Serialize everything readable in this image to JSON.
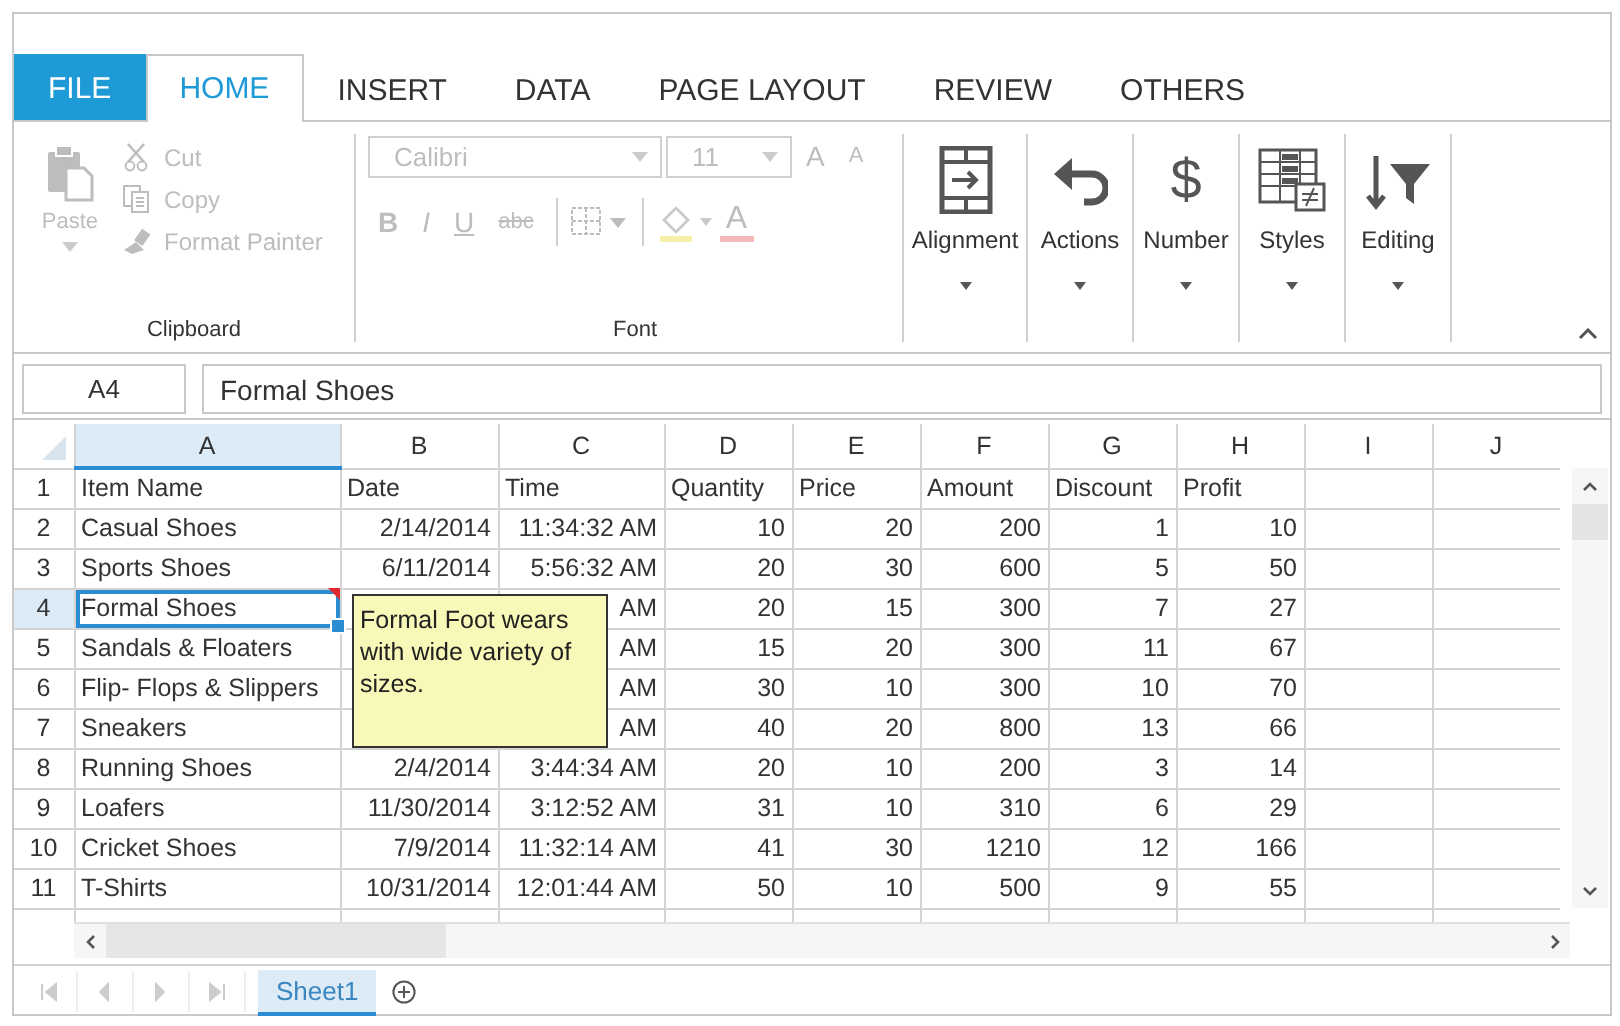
{
  "tabs": [
    {
      "label": "FILE",
      "kind": "file",
      "selected": false
    },
    {
      "label": "HOME",
      "kind": "tab",
      "selected": true
    },
    {
      "label": "INSERT",
      "kind": "tab",
      "selected": false
    },
    {
      "label": "DATA",
      "kind": "tab",
      "selected": false
    },
    {
      "label": "PAGE LAYOUT",
      "kind": "tab",
      "selected": false
    },
    {
      "label": "REVIEW",
      "kind": "tab",
      "selected": false
    },
    {
      "label": "OTHERS",
      "kind": "tab",
      "selected": false
    }
  ],
  "ribbon": {
    "clipboard": {
      "label": "Clipboard",
      "paste": {
        "label": "Paste",
        "disabled": true
      },
      "items": [
        {
          "label": "Cut",
          "kind": "cut",
          "disabled": true
        },
        {
          "label": "Copy",
          "kind": "copy",
          "disabled": true
        },
        {
          "label": "Format Painter",
          "kind": "painter",
          "disabled": true
        }
      ]
    },
    "font": {
      "label": "Font",
      "controls": [
        {
          "kind": "font_name",
          "value": "Calibri",
          "disabled": true
        },
        {
          "kind": "font_size",
          "value": "11",
          "disabled": true
        },
        {
          "kind": "grow",
          "label": "A",
          "disabled": true
        },
        {
          "kind": "shrink",
          "label": "A",
          "disabled": true
        },
        {
          "kind": "bold",
          "label": "B",
          "disabled": true
        },
        {
          "kind": "italic",
          "label": "I",
          "disabled": true
        },
        {
          "kind": "underline",
          "label": "U",
          "disabled": true
        },
        {
          "kind": "strike",
          "label": "abc",
          "disabled": true
        },
        {
          "kind": "borders",
          "disabled": true
        },
        {
          "kind": "fill",
          "disabled": true
        },
        {
          "kind": "font_color",
          "label": "A",
          "disabled": true
        }
      ]
    },
    "groups": [
      {
        "label": "Alignment",
        "kind": "alignment",
        "disabled": false
      },
      {
        "label": "Actions",
        "kind": "undo",
        "disabled": false
      },
      {
        "label": "Number",
        "kind": "symbol",
        "symbol": "$",
        "disabled": false
      },
      {
        "label": "Styles",
        "kind": "styles",
        "disabled": false
      },
      {
        "label": "Editing",
        "kind": "editing",
        "disabled": false
      }
    ]
  },
  "formula_bar": {
    "cell_ref": "A4",
    "value": "Formal Shoes"
  },
  "grid": {
    "columns": [
      {
        "label": "A",
        "selected": true
      },
      {
        "label": "B",
        "selected": false
      },
      {
        "label": "C",
        "selected": false
      },
      {
        "label": "D",
        "selected": false
      },
      {
        "label": "E",
        "selected": false
      },
      {
        "label": "F",
        "selected": false
      },
      {
        "label": "G",
        "selected": false
      },
      {
        "label": "H",
        "selected": false
      },
      {
        "label": "I",
        "selected": false
      },
      {
        "label": "J",
        "selected": false
      }
    ],
    "rows": [
      {
        "header": "1",
        "kind": "heading",
        "selected": false,
        "cells": [
          "Item Name",
          "Date",
          "Time",
          "Quantity",
          "Price",
          "Amount",
          "Discount",
          "Profit"
        ]
      },
      {
        "header": "2",
        "kind": "data",
        "selected": false,
        "cells": [
          "Casual Shoes",
          "2/14/2014",
          "11:34:32 AM",
          "10",
          "20",
          "200",
          "1",
          "10"
        ]
      },
      {
        "header": "3",
        "kind": "data",
        "selected": false,
        "cells": [
          "Sports Shoes",
          "6/11/2014",
          "5:56:32 AM",
          "20",
          "30",
          "600",
          "5",
          "50"
        ]
      },
      {
        "header": "4",
        "kind": "data",
        "selected": true,
        "comment": "Formal Foot wears with wide variety of sizes.",
        "cells": [
          "Formal Shoes",
          null,
          "AM",
          "20",
          "15",
          "300",
          "7",
          "27"
        ]
      },
      {
        "header": "5",
        "kind": "data",
        "selected": false,
        "cells": [
          "Sandals & Floaters",
          null,
          "AM",
          "15",
          "20",
          "300",
          "11",
          "67"
        ]
      },
      {
        "header": "6",
        "kind": "data",
        "selected": false,
        "cells": [
          "Flip- Flops & Slippers",
          null,
          "AM",
          "30",
          "10",
          "300",
          "10",
          "70"
        ]
      },
      {
        "header": "7",
        "kind": "data",
        "selected": false,
        "cells": [
          "Sneakers",
          null,
          "AM",
          "40",
          "20",
          "800",
          "13",
          "66"
        ]
      },
      {
        "header": "8",
        "kind": "data",
        "selected": false,
        "cells": [
          "Running Shoes",
          "2/4/2014",
          "3:44:34 AM",
          "20",
          "10",
          "200",
          "3",
          "14"
        ]
      },
      {
        "header": "9",
        "kind": "data",
        "selected": false,
        "cells": [
          "Loafers",
          "11/30/2014",
          "3:12:52 AM",
          "31",
          "10",
          "310",
          "6",
          "29"
        ]
      },
      {
        "header": "10",
        "kind": "data",
        "selected": false,
        "cells": [
          "Cricket Shoes",
          "7/9/2014",
          "11:32:14 AM",
          "41",
          "30",
          "1210",
          "12",
          "166"
        ]
      },
      {
        "header": "11",
        "kind": "data",
        "selected": false,
        "cells": [
          "T-Shirts",
          "10/31/2014",
          "12:01:44 AM",
          "50",
          "10",
          "500",
          "9",
          "55"
        ]
      }
    ]
  },
  "sheets": [
    {
      "label": "Sheet1",
      "selected": true
    }
  ]
}
